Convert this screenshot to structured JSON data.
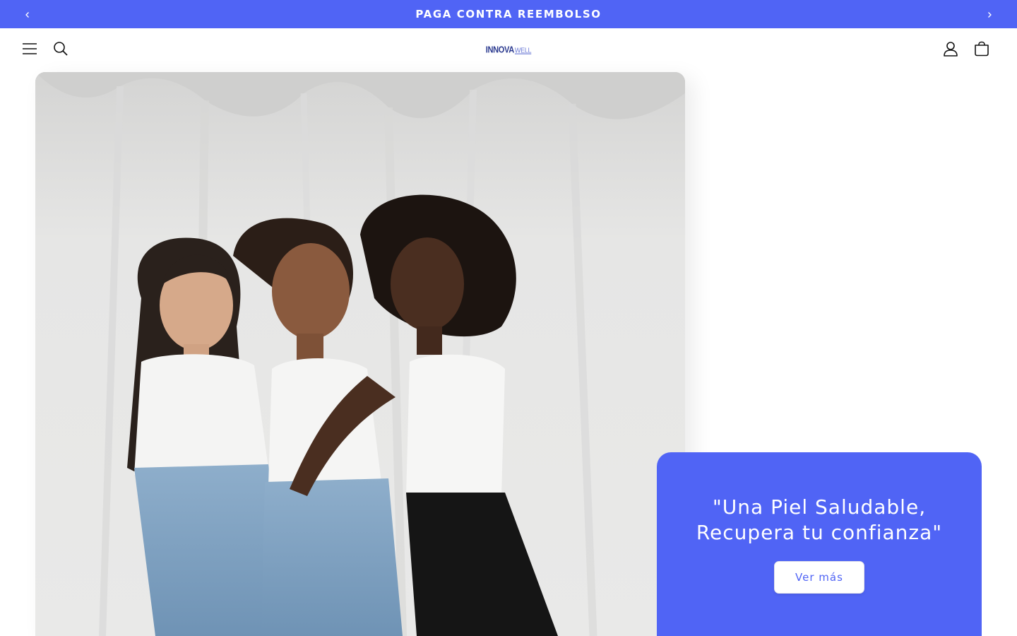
{
  "announcement": {
    "text": "PAGA CONTRA REEMBOLSO",
    "prev_icon": "chevron-left-icon",
    "next_icon": "chevron-right-icon"
  },
  "header": {
    "menu_icon": "hamburger-menu-icon",
    "search_icon": "search-icon",
    "logo": {
      "brand": "INNOVA",
      "suffix": "WELL"
    },
    "account_icon": "account-icon",
    "cart_icon": "cart-icon"
  },
  "hero": {
    "image_icon": "hero-photo"
  },
  "promo": {
    "heading": "\"Una Piel Saludable, Recupera tu confianza\"",
    "button_label": "Ver más"
  },
  "colors": {
    "accent": "#5064f5",
    "background": "#ffffff",
    "text": "#121212"
  }
}
